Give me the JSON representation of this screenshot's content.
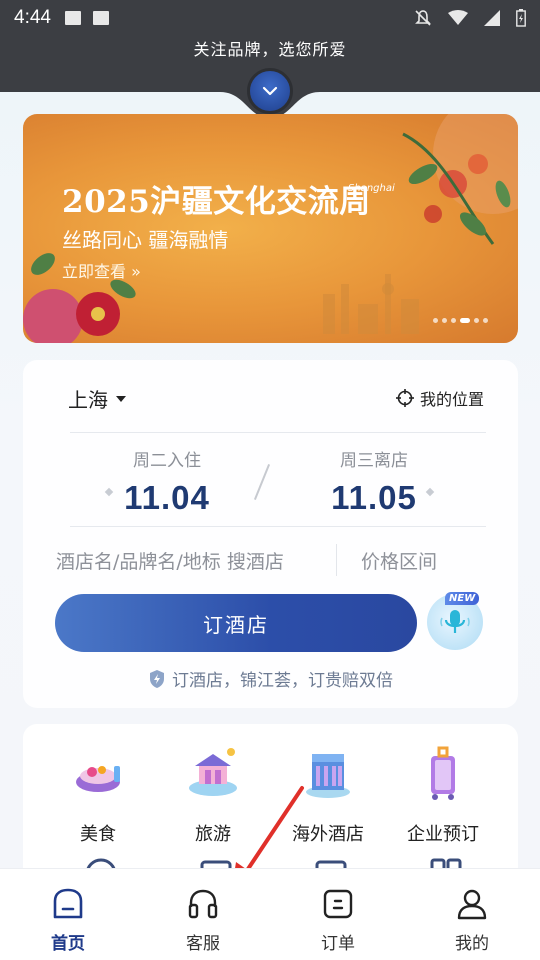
{
  "status_bar": {
    "time": "4:44"
  },
  "brand_bar": {
    "text": "关注品牌，选您所爱"
  },
  "banner": {
    "title": "2025沪疆文化交流周",
    "subtitle": "丝路同心 疆海融情",
    "cta": "立即查看 »",
    "logo_text": "Shanghai",
    "slides": 6,
    "active_slide": 4
  },
  "booking": {
    "city": "上海",
    "my_location": "我的位置",
    "checkin": {
      "label": "周二入住",
      "date": "11.04"
    },
    "checkout": {
      "label": "周三离店",
      "date": "11.05"
    },
    "search_placeholder": "酒店名/品牌名/地标 搜酒店",
    "price_placeholder": "价格区间",
    "book_button": "订酒店",
    "voice_badge": "NEW",
    "guarantee": "订酒店，锦江荟，订贵赔双倍"
  },
  "quick_menu": {
    "items": [
      {
        "label": "美食",
        "icon": "food-icon"
      },
      {
        "label": "旅游",
        "icon": "travel-icon"
      },
      {
        "label": "海外酒店",
        "icon": "overseas-hotel-icon"
      },
      {
        "label": "企业预订",
        "icon": "enterprise-booking-icon"
      }
    ]
  },
  "bottom_nav": {
    "items": [
      {
        "label": "首页",
        "icon": "home-icon",
        "active": true
      },
      {
        "label": "客服",
        "icon": "headset-icon",
        "active": false
      },
      {
        "label": "订单",
        "icon": "order-icon",
        "active": false
      },
      {
        "label": "我的",
        "icon": "profile-icon",
        "active": false
      }
    ]
  },
  "colors": {
    "primary": "#2c4ea9",
    "date_text": "#1f3a72",
    "banner_orange": "#e8963a",
    "annotation_arrow": "#e0302a"
  }
}
